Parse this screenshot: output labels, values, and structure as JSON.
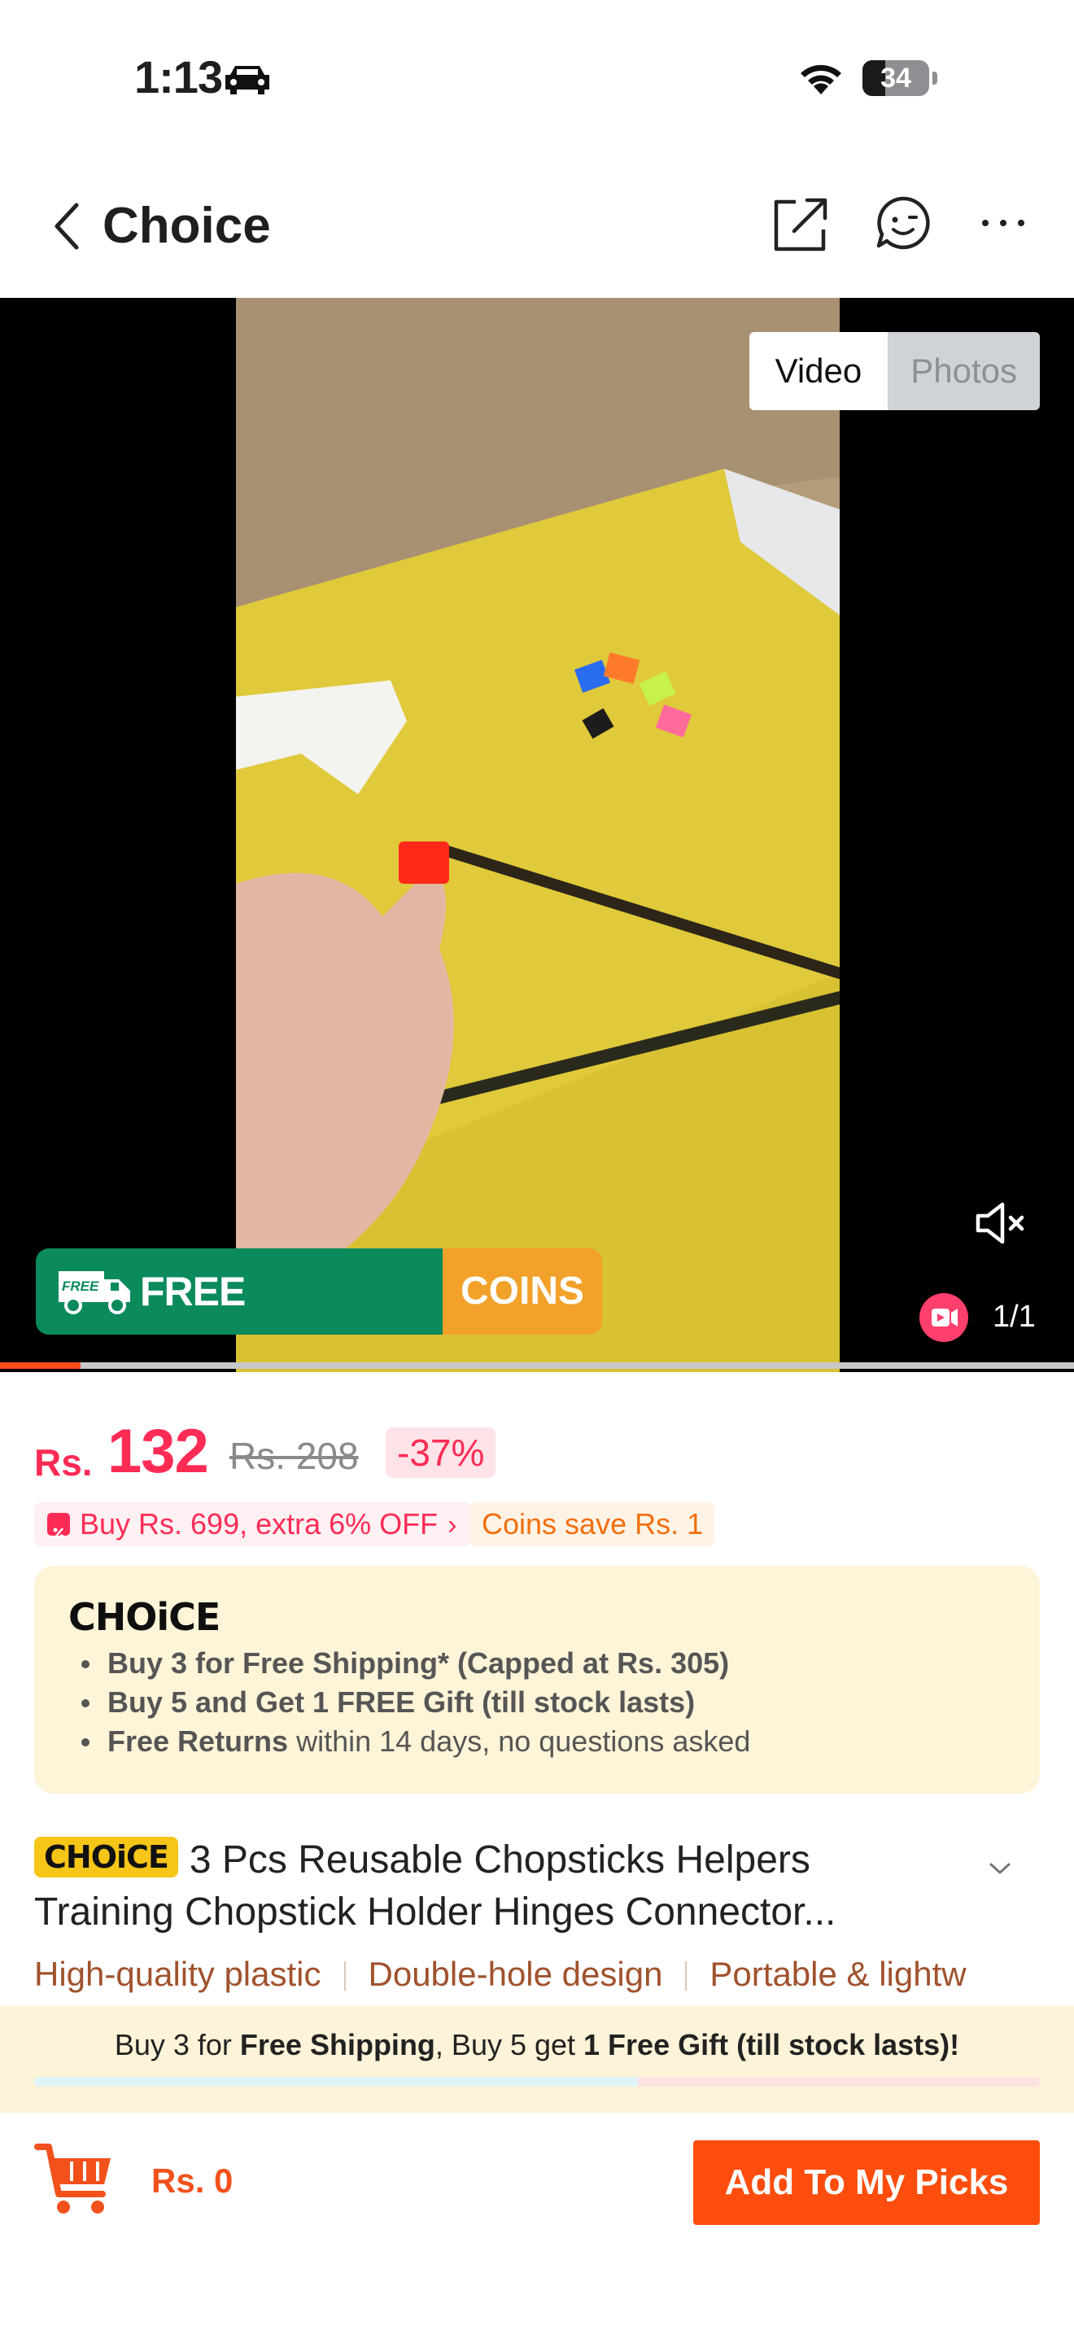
{
  "status_bar": {
    "time": "1:13",
    "battery_level": "34",
    "battery_fraction": 0.34,
    "icons": [
      "car-icon",
      "wifi-icon",
      "battery-icon"
    ]
  },
  "nav": {
    "title": "Choice",
    "icons": [
      "back-icon",
      "share-icon",
      "chat-icon",
      "more-icon"
    ]
  },
  "media": {
    "tabs": {
      "video": "Video",
      "photos": "Photos"
    },
    "active_tab": "Video",
    "counter": "1/1",
    "video_progress": 0.075,
    "banner": {
      "free_shipping": "FREE SHIPPING",
      "coins": "COINS",
      "truck_text": "FREE"
    }
  },
  "price": {
    "currency": "Rs.",
    "current": "132",
    "original": "Rs. 208",
    "discount": "-37%"
  },
  "promos": {
    "bundle": "Buy Rs. 699, extra 6% OFF",
    "coins": "Coins save Rs. 1"
  },
  "choice_card": {
    "logo": "CHOiCE",
    "benefits": [
      {
        "bold": "Buy 3 for  Free Shipping* (Capped at Rs. 305)",
        "rest": ""
      },
      {
        "bold": "Buy 5 and Get 1 FREE Gift (till stock lasts)",
        "rest": ""
      },
      {
        "bold": "Free Returns",
        "rest": " within 14 days, no questions asked"
      }
    ]
  },
  "product": {
    "chip": "CHOiCE",
    "title_line1": "3 Pcs Reusable Chopsticks Helpers",
    "title_line2": "Training Chopstick Holder Hinges Connector...",
    "features": [
      "High-quality plastic",
      "Double-hole design",
      "Portable & lightw"
    ]
  },
  "bottom_promo": {
    "prefix": "Buy 3 for ",
    "bold1": "Free Shipping",
    "middle": ", Buy 5 get ",
    "bold2": "1 Free Gift (till stock lasts)!",
    "progress": 0.6
  },
  "bottom_bar": {
    "cart_total": "Rs. 0",
    "add_button": "Add To My Picks"
  },
  "colors": {
    "accent": "#ff4d0d",
    "price": "#fe2c55",
    "shipping_green": "#0b8a5c",
    "coins_orange": "#f2a12a",
    "choice_yellow": "#f5c518"
  }
}
